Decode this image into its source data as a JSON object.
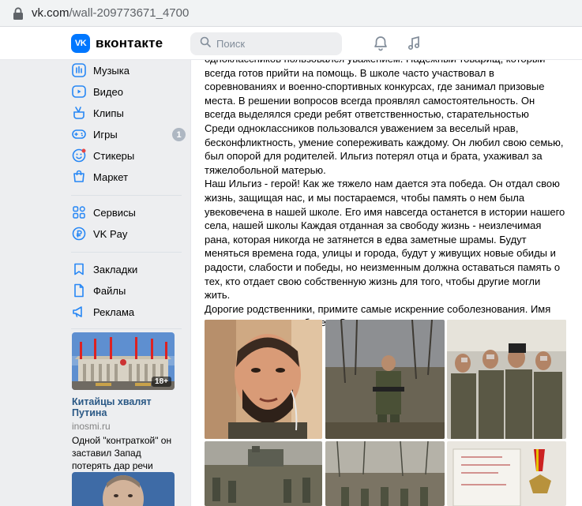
{
  "browser": {
    "url_host": "vk.com",
    "url_path": "/wall-209773671_4700"
  },
  "header": {
    "logo_mark": "VK",
    "logo_text": "вконтакте",
    "search_placeholder": "Поиск",
    "icons": [
      "bell-icon",
      "music-note-icon"
    ]
  },
  "sidebar": {
    "items": [
      {
        "label": "Музыка",
        "icon": "music-icon"
      },
      {
        "label": "Видео",
        "icon": "video-icon"
      },
      {
        "label": "Клипы",
        "icon": "clips-icon"
      },
      {
        "label": "Игры",
        "icon": "gamepad-icon",
        "badge": "1"
      },
      {
        "label": "Стикеры",
        "icon": "sticker-icon"
      },
      {
        "label": "Маркет",
        "icon": "market-icon"
      },
      {
        "label": "Сервисы",
        "icon": "services-icon"
      },
      {
        "label": "VK Pay",
        "icon": "vkpay-icon"
      },
      {
        "label": "Закладки",
        "icon": "bookmark-icon"
      },
      {
        "label": "Файлы",
        "icon": "files-icon"
      },
      {
        "label": "Реклама",
        "icon": "ads-icon"
      }
    ],
    "promo": {
      "title": "Китайцы хвалят Путина",
      "source": "inosmi.ru",
      "description": "Одной \"контраткой\" он заставил Запад потерять дар речи",
      "age_label": "18+"
    }
  },
  "post": {
    "paragraphs": [
      "одноклассников пользовался уважением. Надежный товарищ, который всегда готов прийти на помощь. В школе часто участвовал в соревнованиях и военно-спортивных конкурсах, где занимал призовые места. В решении вопросов всегда проявлял самостоятельность. Он всегда выделялся среди ребят ответственностью, старательностью",
      "Среди одноклассников пользовался уважением за веселый нрав, бесконфликтность, умение сопереживать каждому. Он любил свою семью, был опорой для родителей. Ильгиз потерял отца и брата, ухаживал за тяжелобольной матерью.",
      "Наш Ильгиз - герой! Как же тяжело нам дается эта победа. Он отдал свою жизнь, защищая нас, и мы постараемся, чтобы память о нем была увековечена в нашей школе. Его имя навсегда останется в истории нашего села, нашей школы Каждая отданная за свободу жизнь - неизлечимая рана, которая никогда не затянется в едва заметные шрамы. Будут меняться времена года, улицы и города, будут у живущих новые обиды и радости, слабости и победы, но неизменным должна оставаться память о тех, кто отдает свою собственную жизнь для того, чтобы другие могли жить.",
      "Дорогие родственники, примите самые искренние соболезнования. Имя его мы никогда не забудем. Светлая ему память."
    ]
  },
  "colors": {
    "vk_blue": "#0077ff",
    "link": "#2a5885",
    "page_bg": "#edeef0",
    "icon_blue": "#2787f5"
  }
}
